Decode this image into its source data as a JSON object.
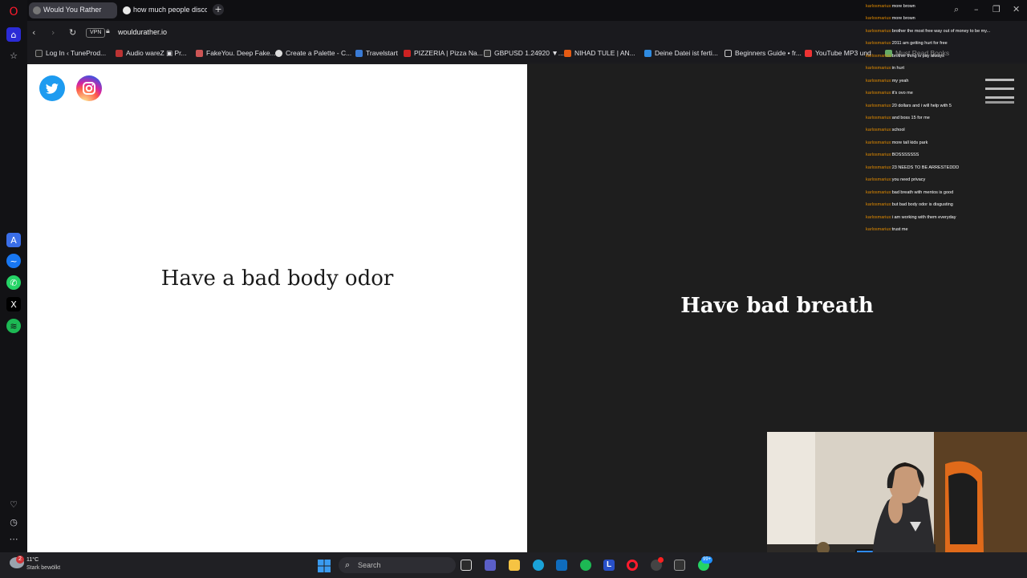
{
  "browser": {
    "tabs": [
      {
        "title": "Would You Rather",
        "active": true
      },
      {
        "title": "how much people discove",
        "active": false
      }
    ],
    "vpn_label": "VPN",
    "url": "wouldurather.io",
    "bookmarks": [
      {
        "label": "Log In ‹ TuneProd..."
      },
      {
        "label": "Audio wareZ ▣ Pr..."
      },
      {
        "label": "FakeYou. Deep Fake..."
      },
      {
        "label": "Create a Palette - C..."
      },
      {
        "label": "Travelstart"
      },
      {
        "label": "PIZZERIA | Pizza Na..."
      },
      {
        "label": "GBPUSD 1.24920 ▼..."
      },
      {
        "label": "NIHAD TULE | AN..."
      },
      {
        "label": "Deine Datei ist ferti..."
      },
      {
        "label": "Beginners Guide • fr..."
      },
      {
        "label": "YouTube MP3 und"
      },
      {
        "label": "Must Read Books"
      }
    ]
  },
  "game": {
    "option_left": "Have a bad body odor",
    "option_right": "Have bad breath"
  },
  "chat": {
    "username": "karlosmarius:",
    "messages": [
      "more brown",
      "more brown",
      "brother the most free way out of money to be my...",
      "2011 am getting hurt for free",
      "brother thing is pay always",
      "in hurt",
      "my yeah",
      "it's ovo me",
      "20 dollars and i will help with 5",
      "and boss 15 for me",
      "school",
      "more tall kids park",
      "BOSSSSSSS",
      "23 NEEDS TO BE ARRESTEDDD",
      "you need privacy",
      "bad breath with mentos is good",
      "but bad body odor is disgusting",
      "i am working with them everyday",
      "trust me"
    ]
  },
  "taskbar": {
    "weather_temp": "11°C",
    "weather_desc": "Stark bewölkt",
    "notification_count": "2",
    "search_placeholder": "Search",
    "badge_count": "99+"
  },
  "colors": {
    "chat_username": "#e08a00",
    "twitter": "#1d9bf0",
    "opera_red": "#ff1b2d"
  }
}
